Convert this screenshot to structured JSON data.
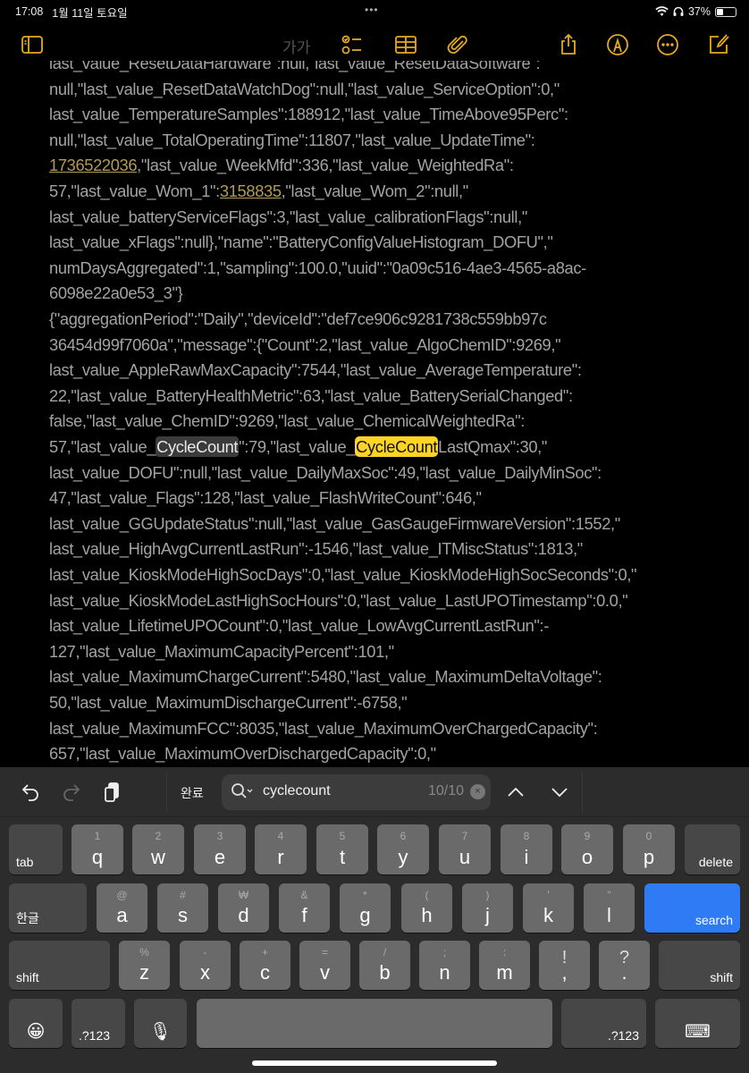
{
  "status": {
    "time": "17:08",
    "date": "1월 11일 토요일",
    "battery": "37%",
    "battery_level": 0.37
  },
  "toolbar": {
    "format_label": "가가",
    "icons": [
      "sidebar-icon",
      "checklist-icon",
      "table-icon",
      "paperclip-icon",
      "share-icon",
      "markup-pen-icon",
      "more-icon",
      "compose-icon"
    ],
    "accent": "#e6a91f"
  },
  "note": {
    "lines": [
      [
        {
          "t": "last_value_ResetDataHardware\":null,\"last_value_ResetDataSoftware\":"
        }
      ],
      [
        {
          "t": "null,\"last_value_ResetDataWatchDog\":null,\"last_value_ServiceOption\":0,\""
        }
      ],
      [
        {
          "t": "last_value_TemperatureSamples\":188912,\"last_value_TimeAbove95Perc\":"
        }
      ],
      [
        {
          "t": "null,\"last_value_TotalOperatingTime\":11807,\"last_value_UpdateTime\":"
        }
      ],
      [
        {
          "t": "1736522036",
          "s": "link"
        },
        {
          "t": ",\"last_value_WeekMfd\":336,\"last_value_WeightedRa\":"
        }
      ],
      [
        {
          "t": "57,\"last_value_Wom_1\":"
        },
        {
          "t": "3158835",
          "s": "link"
        },
        {
          "t": ",\"last_value_Wom_2\":null,\""
        }
      ],
      [
        {
          "t": "last_value_batteryServiceFlags\":3,\"last_value_calibrationFlags\":null,\""
        }
      ],
      [
        {
          "t": "last_value_xFlags\":null},\"name\":\"BatteryConfigValueHistogram_DOFU\",\""
        }
      ],
      [
        {
          "t": "numDaysAggregated\":1,\"sampling\":100.0,\"uuid\":\"0a09c516-4ae3-4565-a8ac-"
        }
      ],
      [
        {
          "t": "6098e22a0e53_3\"}"
        }
      ],
      [
        {
          "t": "{\"aggregationPeriod\":\"Daily\",\"deviceId\":\"def7ce906c9281738c559bb97c"
        }
      ],
      [
        {
          "t": "36454d99f7060a\",\"message\":{\"Count\":2,\"last_value_AlgoChemID\":9269,\""
        }
      ],
      [
        {
          "t": "last_value_AppleRawMaxCapacity\":7544,\"last_value_AverageTemperature\":"
        }
      ],
      [
        {
          "t": "22,\"last_value_BatteryHealthMetric\":63,\"last_value_BatterySerialChanged\":"
        }
      ],
      [
        {
          "t": "false,\"last_value_ChemID\":9269,\"last_value_ChemicalWeightedRa\":"
        }
      ],
      [
        {
          "t": "57,\"last_value_"
        },
        {
          "t": "CycleCount",
          "s": "hl-oth"
        },
        {
          "t": "\":79,\"last_value_"
        },
        {
          "t": "CycleCount",
          "s": "hl-cur"
        },
        {
          "t": "LastQmax\":30,\""
        }
      ],
      [
        {
          "t": "last_value_DOFU\":null,\"last_value_DailyMaxSoc\":49,\"last_value_DailyMinSoc\":"
        }
      ],
      [
        {
          "t": "47,\"last_value_Flags\":128,\"last_value_FlashWriteCount\":646,\""
        }
      ],
      [
        {
          "t": "last_value_GGUpdateStatus\":null,\"last_value_GasGaugeFirmwareVersion\":1552,\""
        }
      ],
      [
        {
          "t": "last_value_HighAvgCurrentLastRun\":-1546,\"last_value_ITMiscStatus\":1813,\""
        }
      ],
      [
        {
          "t": "last_value_KioskModeHighSocDays\":0,\"last_value_KioskModeHighSocSeconds\":0,\""
        }
      ],
      [
        {
          "t": "last_value_KioskModeLastHighSocHours\":0,\"last_value_LastUPOTimestamp\":0.0,\""
        }
      ],
      [
        {
          "t": "last_value_LifetimeUPOCount\":0,\"last_value_LowAvgCurrentLastRun\":-"
        }
      ],
      [
        {
          "t": "127,\"last_value_MaximumCapacityPercent\":101,\""
        }
      ],
      [
        {
          "t": "last_value_MaximumChargeCurrent\":5480,\"last_value_MaximumDeltaVoltage\":"
        }
      ],
      [
        {
          "t": "50,\"last_value_MaximumDischargeCurrent\":-6758,\""
        }
      ],
      [
        {
          "t": "last_value_MaximumFCC\":8035,\"last_value_MaximumOverChargedCapacity\":"
        }
      ],
      [
        {
          "t": "657,\"last_value_MaximumOverDischargedCapacity\":0,\""
        }
      ]
    ]
  },
  "find": {
    "done_label": "완료",
    "query": "cyclecount",
    "match_count": "10/10",
    "clear": "×"
  },
  "keyboard": {
    "rows": [
      [
        {
          "m": "tab",
          "k": "special"
        },
        {
          "m": "q",
          "s": "1"
        },
        {
          "m": "w",
          "s": "2"
        },
        {
          "m": "e",
          "s": "3"
        },
        {
          "m": "r",
          "s": "4"
        },
        {
          "m": "t",
          "s": "5"
        },
        {
          "m": "y",
          "s": "6"
        },
        {
          "m": "u",
          "s": "7"
        },
        {
          "m": "i",
          "s": "8"
        },
        {
          "m": "o",
          "s": "9"
        },
        {
          "m": "p",
          "s": "0"
        },
        {
          "m": "delete",
          "k": "special"
        }
      ],
      [
        {
          "m": "한글",
          "k": "special"
        },
        {
          "m": "a",
          "s": "@"
        },
        {
          "m": "s",
          "s": "#"
        },
        {
          "m": "d",
          "s": "₩"
        },
        {
          "m": "f",
          "s": "&"
        },
        {
          "m": "g",
          "s": "*"
        },
        {
          "m": "h",
          "s": "("
        },
        {
          "m": "j",
          "s": ")"
        },
        {
          "m": "k",
          "s": "'"
        },
        {
          "m": "l",
          "s": "\""
        },
        {
          "m": "search",
          "k": "blue"
        }
      ],
      [
        {
          "m": "shift",
          "k": "special"
        },
        {
          "m": "z",
          "s": "%"
        },
        {
          "m": "x",
          "s": "-"
        },
        {
          "m": "c",
          "s": "+"
        },
        {
          "m": "v",
          "s": "="
        },
        {
          "m": "b",
          "s": "/"
        },
        {
          "m": "n",
          "s": ";"
        },
        {
          "m": "m",
          "s": ":"
        },
        {
          "m": ",",
          "s": "!"
        },
        {
          "m": ".",
          "s": "?"
        },
        {
          "m": "shift",
          "k": "special",
          "r": true
        }
      ],
      [
        {
          "m": "😀",
          "k": "special",
          "icon": "emoji-icon"
        },
        {
          "m": ".?123",
          "k": "special"
        },
        {
          "m": "🎙",
          "k": "special",
          "icon": "microphone-icon"
        },
        {
          "m": "",
          "k": "space"
        },
        {
          "m": ".?123",
          "k": "special",
          "r": true
        },
        {
          "m": "⌨",
          "k": "special",
          "icon": "keyboard-dismiss-icon"
        }
      ]
    ]
  }
}
